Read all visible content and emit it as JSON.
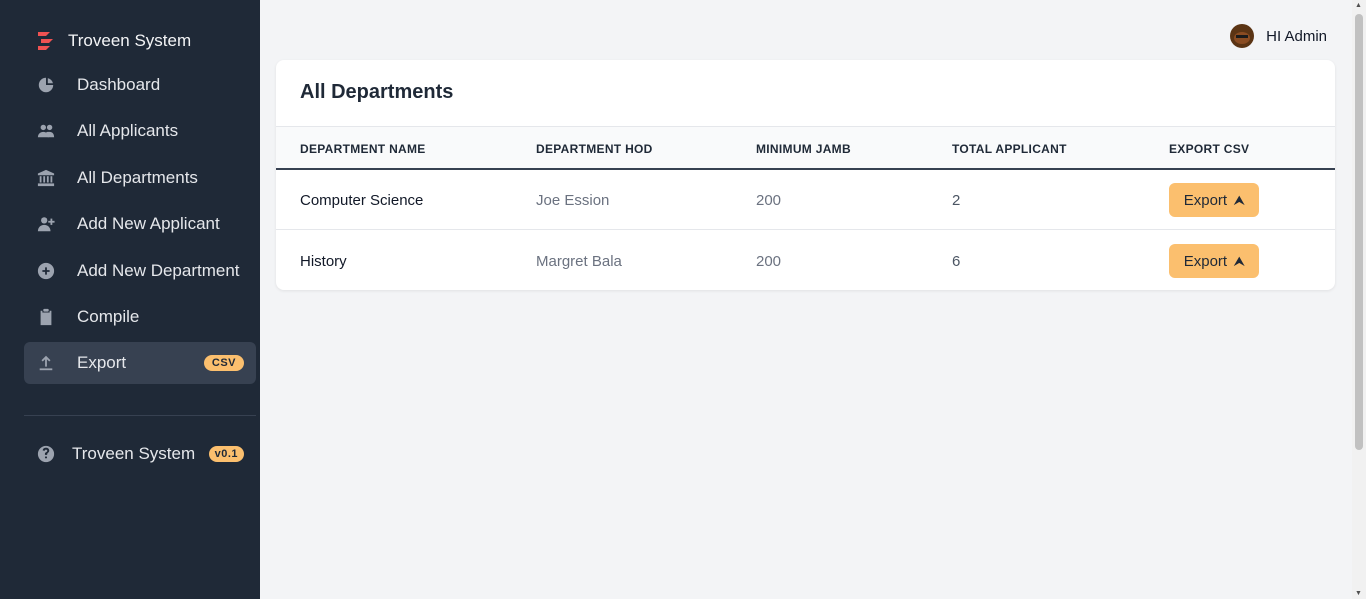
{
  "sidebar": {
    "brand": "Troveen System",
    "items": [
      {
        "label": "Dashboard",
        "icon": "pie-chart-icon"
      },
      {
        "label": "All Applicants",
        "icon": "users-icon"
      },
      {
        "label": "All Departments",
        "icon": "building-icon"
      },
      {
        "label": "Add New Applicant",
        "icon": "user-add-icon"
      },
      {
        "label": "Add New Department",
        "icon": "plus-circle-icon"
      },
      {
        "label": "Compile",
        "icon": "clipboard-icon"
      },
      {
        "label": "Export",
        "icon": "upload-icon",
        "badge": "CSV",
        "active": true
      }
    ],
    "footer": {
      "label": "Troveen System",
      "badge": "v0.1",
      "icon": "question-circle-icon"
    }
  },
  "header": {
    "greeting": "HI Admin"
  },
  "main": {
    "title": "All Departments",
    "columns": [
      "DEPARTMENT NAME",
      "DEPARTMENT HOD",
      "MINIMUM JAMB",
      "TOTAL APPLICANT",
      "EXPORT CSV"
    ],
    "rows": [
      {
        "name": "Computer Science",
        "hod": "Joe Ession",
        "jamb": "200",
        "total": "2",
        "action": "Export"
      },
      {
        "name": "History",
        "hod": "Margret Bala",
        "jamb": "200",
        "total": "6",
        "action": "Export"
      }
    ]
  },
  "colors": {
    "sidebar": "#1f2937",
    "accent": "#fbbf6e",
    "logo": "#f05252"
  }
}
